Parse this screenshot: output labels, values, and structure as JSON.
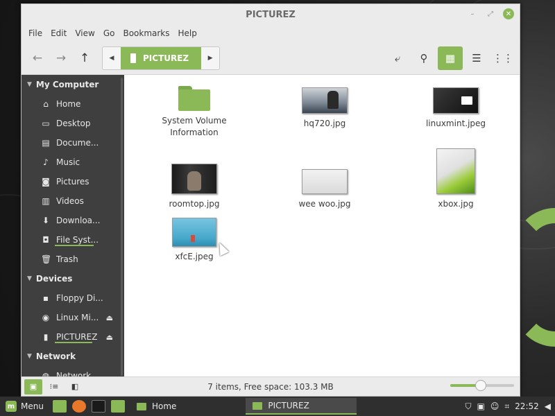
{
  "window": {
    "title": "PICTUREZ",
    "controls": {
      "minimize": "–",
      "maximize": "⤢",
      "close": "✕"
    }
  },
  "menubar": [
    "File",
    "Edit",
    "View",
    "Go",
    "Bookmarks",
    "Help"
  ],
  "toolbar": {
    "location": "PICTUREZ",
    "icons": [
      "back-arrow-icon",
      "forward-arrow-icon",
      "up-arrow-icon",
      "toggle-location-icon",
      "search-icon",
      "icon-view-icon",
      "list-view-icon",
      "compact-view-icon"
    ]
  },
  "sidebar": {
    "sections": [
      {
        "title": "My Computer",
        "items": [
          {
            "label": "Home",
            "icon": "home-icon"
          },
          {
            "label": "Desktop",
            "icon": "desktop-icon"
          },
          {
            "label": "Docume...",
            "icon": "document-icon"
          },
          {
            "label": "Music",
            "icon": "music-icon"
          },
          {
            "label": "Pictures",
            "icon": "camera-icon"
          },
          {
            "label": "Videos",
            "icon": "film-icon"
          },
          {
            "label": "Downloa...",
            "icon": "download-icon"
          },
          {
            "label": "File Syst...",
            "icon": "drive-icon"
          },
          {
            "label": "Trash",
            "icon": "trash-icon"
          }
        ]
      },
      {
        "title": "Devices",
        "items": [
          {
            "label": "Floppy Di...",
            "icon": "floppy-icon"
          },
          {
            "label": "Linux Mi...",
            "icon": "disc-icon"
          },
          {
            "label": "PICTUREZ",
            "icon": "usb-drive-icon"
          }
        ]
      },
      {
        "title": "Network",
        "items": [
          {
            "label": "Network",
            "icon": "network-icon"
          }
        ]
      }
    ]
  },
  "files": [
    {
      "name": "System Volume Information",
      "type": "folder"
    },
    {
      "name": "hq720.jpg",
      "type": "image"
    },
    {
      "name": "linuxmint.jpeg",
      "type": "image"
    },
    {
      "name": "roomtop.jpg",
      "type": "image"
    },
    {
      "name": "wee woo.jpg",
      "type": "image"
    },
    {
      "name": "xbox.jpg",
      "type": "image"
    },
    {
      "name": "xfcE.jpeg",
      "type": "image"
    }
  ],
  "statusbar": {
    "text": "7 items, Free space: 103.3 MB",
    "zoom_level": 0.48
  },
  "taskbar": {
    "menu_label": "Menu",
    "windows": [
      {
        "label": "Home",
        "active": false
      },
      {
        "label": "PICTUREZ",
        "active": true
      }
    ],
    "clock": "22:52"
  },
  "colors": {
    "accent": "#8bb957",
    "sidebar_bg": "#3f3f3f",
    "taskbar_bg": "#2f2f2f"
  }
}
